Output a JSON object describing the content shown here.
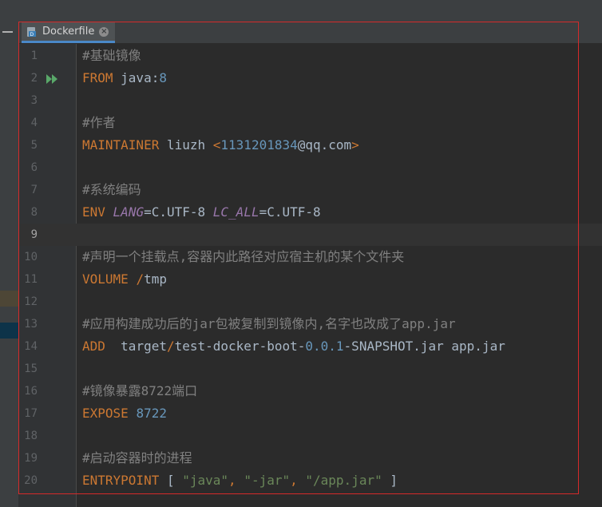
{
  "tab": {
    "label": "Dockerfile",
    "icon": "docker-file-icon"
  },
  "current_line": 9,
  "colors": {
    "keyword": "#cc7832",
    "comment": "#808080",
    "plain": "#a9b7c6",
    "number": "#6897bb",
    "string": "#6a8759",
    "variable": "#9876aa",
    "tab_underline": "#4a88c7",
    "highlight_frame": "#d52a2a"
  },
  "lines": [
    {
      "n": "1",
      "tokens": [
        {
          "t": "comment",
          "v": "#基础镜像"
        }
      ]
    },
    {
      "n": "2",
      "run": true,
      "tokens": [
        {
          "t": "kw",
          "v": "FROM"
        },
        {
          "t": "plain",
          "v": " java:"
        },
        {
          "t": "num",
          "v": "8"
        }
      ]
    },
    {
      "n": "3",
      "tokens": []
    },
    {
      "n": "4",
      "tokens": [
        {
          "t": "comment",
          "v": "#作者"
        }
      ]
    },
    {
      "n": "5",
      "tokens": [
        {
          "t": "kw",
          "v": "MAINTAINER"
        },
        {
          "t": "plain",
          "v": " liuzh "
        },
        {
          "t": "kw",
          "v": "<"
        },
        {
          "t": "num",
          "v": "1131201834"
        },
        {
          "t": "plain",
          "v": "@qq.com"
        },
        {
          "t": "kw",
          "v": ">"
        }
      ]
    },
    {
      "n": "6",
      "tokens": []
    },
    {
      "n": "7",
      "tokens": [
        {
          "t": "comment",
          "v": "#系统编码"
        }
      ]
    },
    {
      "n": "8",
      "tokens": [
        {
          "t": "kw",
          "v": "ENV"
        },
        {
          "t": "plain",
          "v": " "
        },
        {
          "t": "var",
          "v": "LANG"
        },
        {
          "t": "plain",
          "v": "=C.UTF-8 "
        },
        {
          "t": "var",
          "v": "LC_ALL"
        },
        {
          "t": "plain",
          "v": "=C.UTF-8"
        }
      ]
    },
    {
      "n": "9",
      "tokens": []
    },
    {
      "n": "10",
      "tokens": [
        {
          "t": "comment",
          "v": "#声明一个挂载点,容器内此路径对应宿主机的某个文件夹"
        }
      ]
    },
    {
      "n": "11",
      "tokens": [
        {
          "t": "kw",
          "v": "VOLUME"
        },
        {
          "t": "plain",
          "v": " "
        },
        {
          "t": "kw",
          "v": "/"
        },
        {
          "t": "plain",
          "v": "tmp"
        }
      ]
    },
    {
      "n": "12",
      "tokens": []
    },
    {
      "n": "13",
      "tokens": [
        {
          "t": "comment",
          "v": "#应用构建成功后的jar包被复制到镜像内,名字也改成了app.jar"
        }
      ]
    },
    {
      "n": "14",
      "tokens": [
        {
          "t": "kw",
          "v": "ADD"
        },
        {
          "t": "plain",
          "v": "  target"
        },
        {
          "t": "kw",
          "v": "/"
        },
        {
          "t": "plain",
          "v": "test-docker-boot-"
        },
        {
          "t": "num",
          "v": "0.0.1"
        },
        {
          "t": "plain",
          "v": "-SNAPSHOT.jar app.jar"
        }
      ]
    },
    {
      "n": "15",
      "tokens": []
    },
    {
      "n": "16",
      "tokens": [
        {
          "t": "comment",
          "v": "#镜像暴露8722端口"
        }
      ]
    },
    {
      "n": "17",
      "tokens": [
        {
          "t": "kw",
          "v": "EXPOSE"
        },
        {
          "t": "plain",
          "v": " "
        },
        {
          "t": "num",
          "v": "8722"
        }
      ]
    },
    {
      "n": "18",
      "tokens": []
    },
    {
      "n": "19",
      "tokens": [
        {
          "t": "comment",
          "v": "#启动容器时的进程"
        }
      ]
    },
    {
      "n": "20",
      "tokens": [
        {
          "t": "kw",
          "v": "ENTRYPOINT"
        },
        {
          "t": "plain",
          "v": " [ "
        },
        {
          "t": "str",
          "v": "\"java\""
        },
        {
          "t": "kw",
          "v": ","
        },
        {
          "t": "plain",
          "v": " "
        },
        {
          "t": "str",
          "v": "\"-jar\""
        },
        {
          "t": "kw",
          "v": ","
        },
        {
          "t": "plain",
          "v": " "
        },
        {
          "t": "str",
          "v": "\"/app.jar\""
        },
        {
          "t": "plain",
          "v": " ]"
        }
      ]
    }
  ]
}
